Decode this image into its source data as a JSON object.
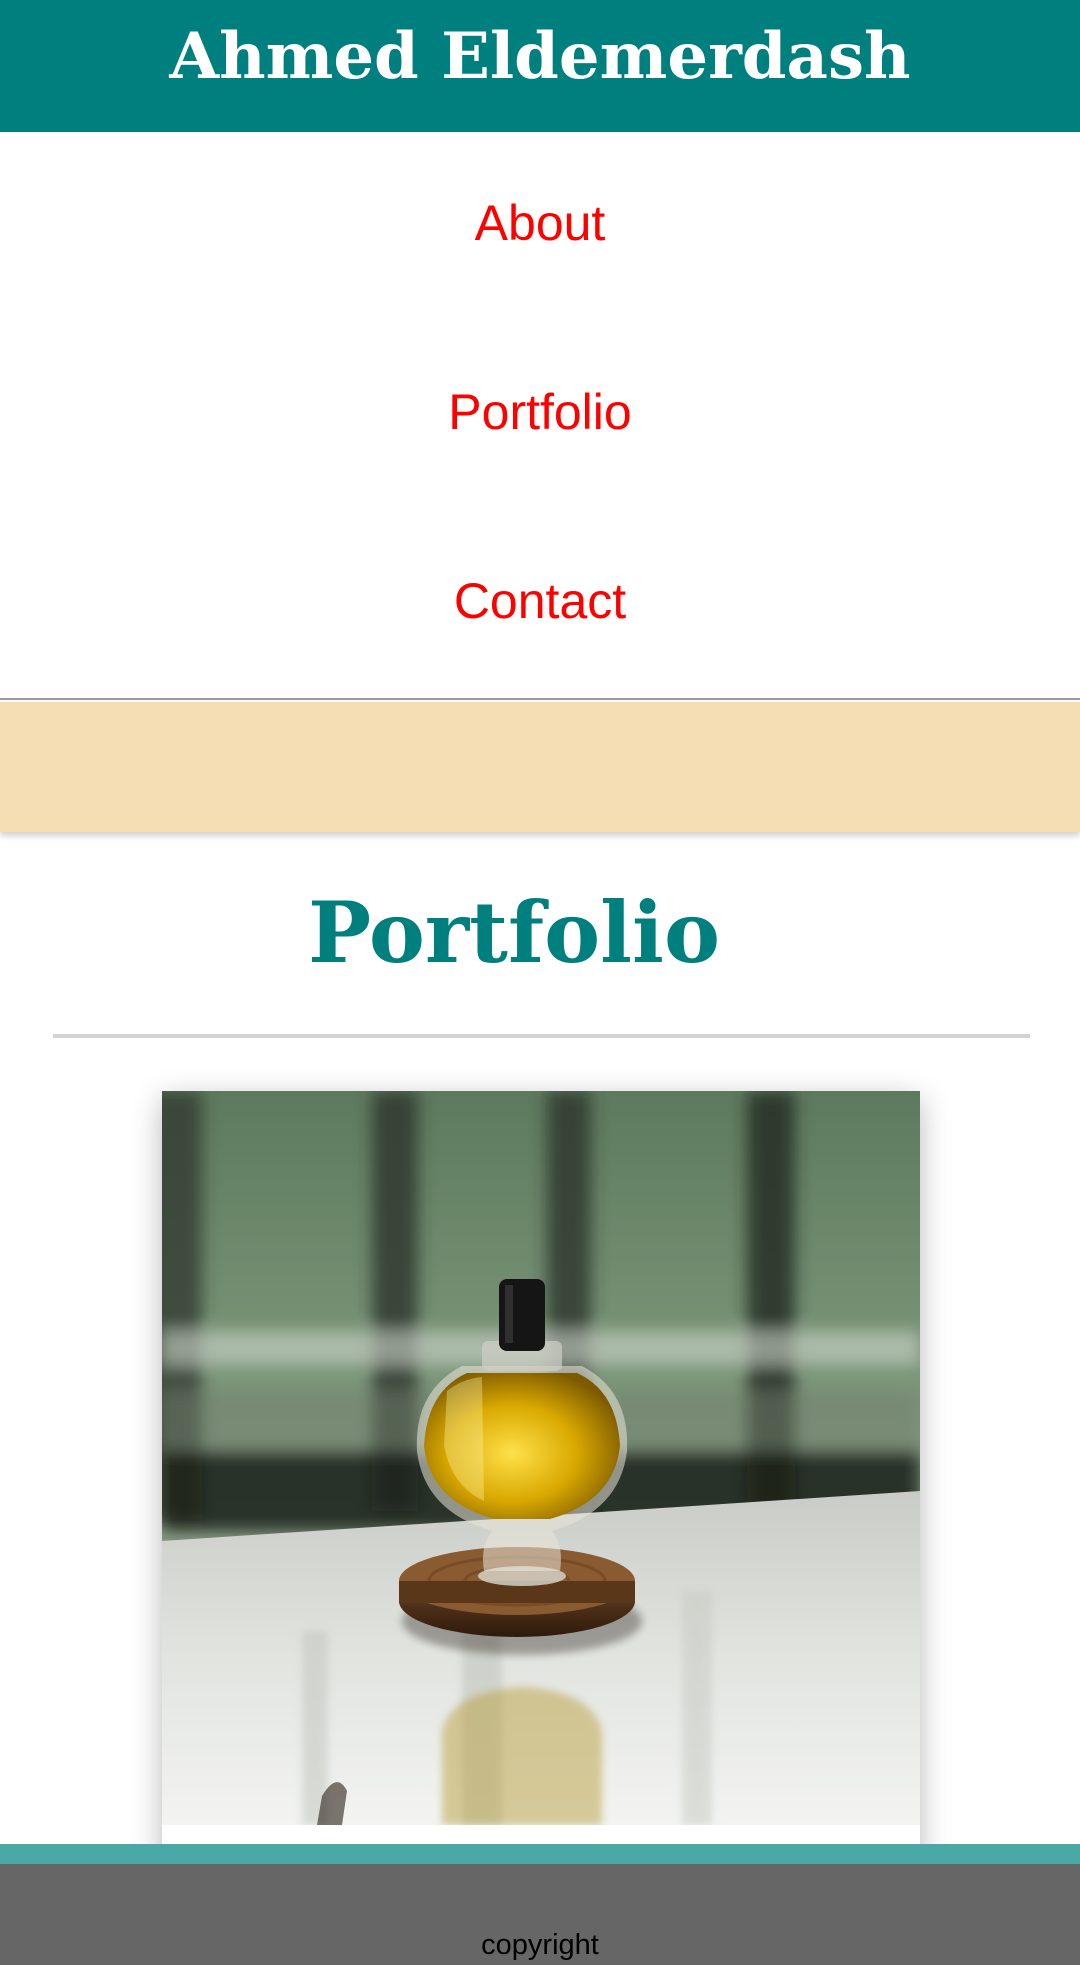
{
  "header": {
    "title": "Ahmed Eldemerdash"
  },
  "nav": {
    "items": [
      {
        "label": "About"
      },
      {
        "label": "Portfolio"
      },
      {
        "label": "Contact"
      }
    ]
  },
  "portfolio": {
    "title": "Portfolio",
    "items": [
      {
        "image_icon": "perfume-bottle-photo"
      }
    ]
  },
  "footer": {
    "copyright": "copyright"
  },
  "colors": {
    "header_bg": "#007f7f",
    "nav_link": "#ff0000",
    "banner_bg": "#f5deb3",
    "section_title": "#007f7f",
    "footer_accent": "#4aa8a6",
    "footer_bg": "#666666"
  }
}
